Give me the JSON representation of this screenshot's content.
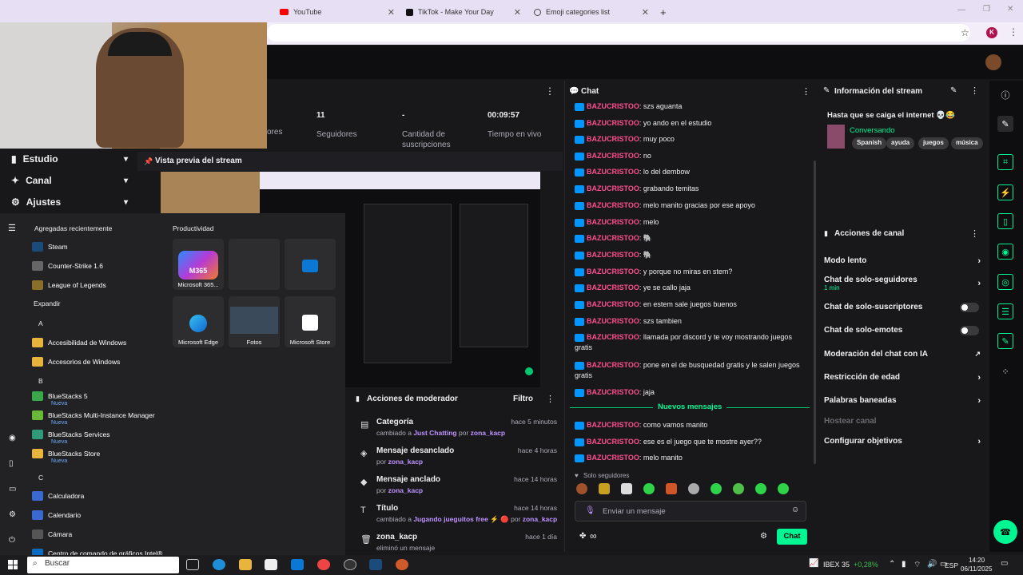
{
  "browser": {
    "tabs": [
      {
        "label": "YouTube"
      },
      {
        "label": "TikTok - Make Your Day"
      },
      {
        "label": "Emoji categories list"
      }
    ],
    "new_tab": "+",
    "profile_initial": "K"
  },
  "stats": [
    {
      "value": "",
      "label": "ores"
    },
    {
      "value": "11",
      "label": "Seguidores"
    },
    {
      "value": "-",
      "label": "Cantidad de suscripciones"
    },
    {
      "value": "00:09:57",
      "label": "Tiempo en vivo"
    }
  ],
  "left_nav": [
    {
      "label": "Estudio"
    },
    {
      "label": "Canal"
    },
    {
      "label": "Ajustes"
    }
  ],
  "preview": {
    "title": "Vista previa del stream"
  },
  "start_menu": {
    "recent_header": "Agregadas recientemente",
    "recent": [
      "Steam",
      "Counter-Strike 1.6",
      "League of Legends"
    ],
    "expand": "Expandir",
    "letter_a": "A",
    "a_items": [
      "Accesibilidad de Windows",
      "Accesorios de Windows"
    ],
    "letter_b": "B",
    "b_items": [
      "BlueStacks 5",
      "BlueStacks Multi-Instance Manager",
      "BlueStacks Services",
      "BlueStacks Store"
    ],
    "new_label": "Nueva",
    "letter_c": "C",
    "c_items": [
      "Calculadora",
      "Calendario",
      "Cámara",
      "Centro de comando de gráficos Intel®"
    ],
    "productivity_header": "Productividad",
    "tiles": [
      "Microsoft 365...",
      "",
      "",
      "Microsoft Edge",
      "Fotos",
      "Microsoft Store"
    ],
    "m365_label": "M365"
  },
  "mod_actions": {
    "title": "Acciones de moderador",
    "filter": "Filtro",
    "items": [
      {
        "title": "Categoría",
        "sub1": "cambiado a ",
        "hl1": "Just Chatting",
        "sub2": " por ",
        "hl2": "zona_kacp",
        "time": "hace 5 minutos"
      },
      {
        "title": "Mensaje desanclado",
        "sub1": "por ",
        "hl1": "zona_kacp",
        "sub2": "",
        "hl2": "",
        "time": "hace 4 horas"
      },
      {
        "title": "Mensaje anclado",
        "sub1": "por ",
        "hl1": "zona_kacp",
        "sub2": "",
        "hl2": "",
        "time": "hace 14 horas"
      },
      {
        "title": "Título",
        "sub1": "cambiado a ",
        "hl1": "Jugando jueguitos free ⚡ 🔴",
        "sub2": " por ",
        "hl2": "zona_kacp",
        "time": "hace 14 horas"
      },
      {
        "title": "zona_kacp",
        "sub1": "eliminó un mensaje",
        "hl1": "",
        "sub2": "",
        "hl2": "",
        "time": "hace 1 día"
      }
    ]
  },
  "chat": {
    "title": "Chat",
    "username": "BAZUCRISTOO",
    "messages": [
      {
        "text": ": szs aguanta"
      },
      {
        "text": ": yo ando en el estudio"
      },
      {
        "text": ": muy poco"
      },
      {
        "text": ": no"
      },
      {
        "text": ": lo del dembow"
      },
      {
        "text": ": grabando temitas"
      },
      {
        "text": ": melo manito gracias por ese apoyo"
      },
      {
        "text": ": melo"
      },
      {
        "text": ": 🐘"
      },
      {
        "text": ": 🐘"
      },
      {
        "text": ": y porque no miras en stem?"
      },
      {
        "text": ": ye se callo jaja"
      },
      {
        "text": ": en estem sale juegos buenos"
      },
      {
        "text": ": szs tambien"
      },
      {
        "text": ": llamada por discord y te voy mostrando juegos gratis"
      },
      {
        "text": ": pone en el de busquedad gratis y le salen juegos gratis"
      },
      {
        "text": ": jaja"
      }
    ],
    "new_messages": "Nuevos mensajes",
    "new_list": [
      {
        "text": ": como vamos manito"
      },
      {
        "text": ": ese es el juego que te mostre ayer??"
      },
      {
        "text": ": melo manito"
      }
    ],
    "followers_only": "Solo seguidores",
    "input_placeholder": "Enviar un mensaje",
    "points": "∞",
    "send": "Chat"
  },
  "stream_info": {
    "title": "Información del stream",
    "stream_title": "Hasta que se caiga el internet 💀😂",
    "category": "Conversando",
    "tags": [
      "Spanish",
      "ayuda",
      "juegos",
      "música"
    ]
  },
  "channel_actions": {
    "title": "Acciones de canal",
    "items": [
      {
        "label": "Modo lento",
        "sub": "",
        "type": "chevron"
      },
      {
        "label": "Chat de solo-seguidores",
        "sub": "1 min",
        "type": "chevron"
      },
      {
        "label": "Chat de solo-suscriptores",
        "sub": "",
        "type": "toggle"
      },
      {
        "label": "Chat de solo-emotes",
        "sub": "",
        "type": "toggle"
      },
      {
        "label": "Moderación del chat con IA",
        "sub": "",
        "type": "external"
      },
      {
        "label": "Restricción de edad",
        "sub": "",
        "type": "chevron"
      },
      {
        "label": "Palabras baneadas",
        "sub": "",
        "type": "chevron"
      },
      {
        "label": "Hostear canal",
        "sub": "",
        "type": "disabled"
      },
      {
        "label": "Configurar objetivos",
        "sub": "",
        "type": "chevron"
      }
    ]
  },
  "taskbar": {
    "search_placeholder": "Buscar",
    "ticker": "IBEX 35",
    "ticker_change": "+0,28%",
    "lang": "ESP",
    "time": "14:20",
    "date": "06/11/2025"
  },
  "colors": {
    "accent": "#00f593",
    "username": "#ff4f8f",
    "highlight": "#bf94ff",
    "send_button": "#00f593"
  }
}
